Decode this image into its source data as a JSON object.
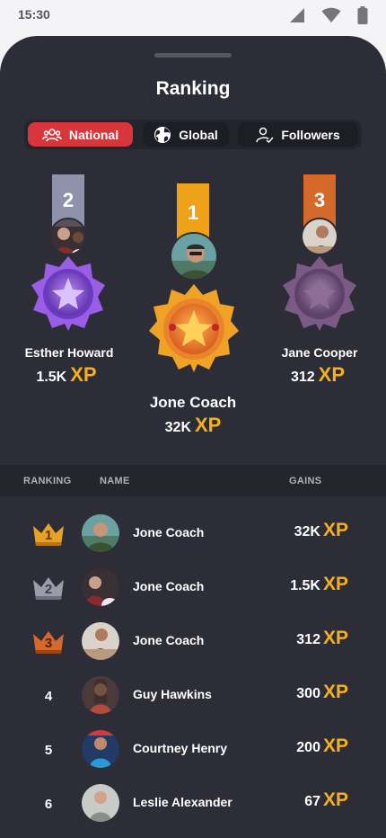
{
  "status": {
    "time": "15:30"
  },
  "title": "Ranking",
  "tabs": [
    {
      "label": "National",
      "icon": "users-icon",
      "active": true
    },
    {
      "label": "Global",
      "icon": "globe-icon",
      "active": false
    },
    {
      "label": "Followers",
      "icon": "user-check-icon",
      "active": false
    }
  ],
  "podium": [
    {
      "place": "2",
      "name": "Esther Howard",
      "xp": "1.5K",
      "xp_label": "XP",
      "medal": "purple-star-medal",
      "ribbon_color": "#8f92ab"
    },
    {
      "place": "1",
      "name": "Jone Coach",
      "xp": "32K",
      "xp_label": "XP",
      "medal": "gold-star-medal",
      "ribbon_color": "#eea21a"
    },
    {
      "place": "3",
      "name": "Jane Cooper",
      "xp": "312",
      "xp_label": "XP",
      "medal": "bronze-star-medal",
      "ribbon_color": "#d5692a"
    }
  ],
  "table": {
    "headers": {
      "rank": "RANKING",
      "name": "NAME",
      "gains": "GAINS"
    },
    "rows": [
      {
        "rank": "1",
        "crown": "gold",
        "name": "Jone Coach",
        "xp": "32K",
        "xp_label": "XP"
      },
      {
        "rank": "2",
        "crown": "silver",
        "name": "Jone Coach",
        "xp": "1.5K",
        "xp_label": "XP"
      },
      {
        "rank": "3",
        "crown": "bronze",
        "name": "Jone Coach",
        "xp": "312",
        "xp_label": "XP"
      },
      {
        "rank": "4",
        "crown": "",
        "name": "Guy Hawkins",
        "xp": "300",
        "xp_label": "XP"
      },
      {
        "rank": "5",
        "crown": "",
        "name": "Courtney Henry",
        "xp": "200",
        "xp_label": "XP"
      },
      {
        "rank": "6",
        "crown": "",
        "name": "Leslie Alexander",
        "xp": "67",
        "xp_label": "XP"
      }
    ]
  },
  "colors": {
    "accent": "#d8363b",
    "xp": "#f6b01e",
    "background": "#2c2d37",
    "gold": "#e8a227",
    "silver": "#9a9caa",
    "bronze": "#d5692a"
  }
}
